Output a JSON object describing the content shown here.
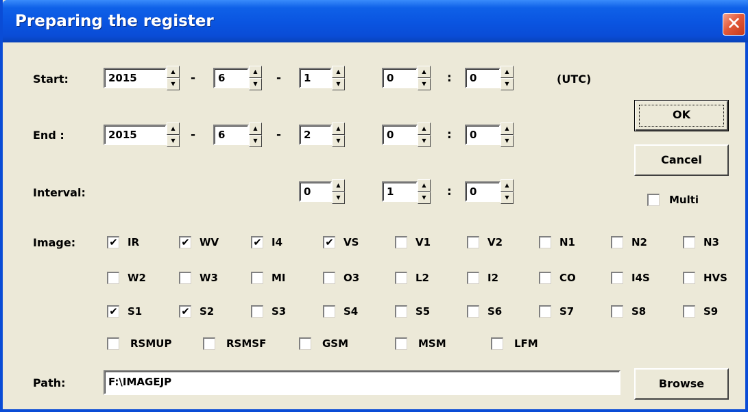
{
  "window": {
    "title": "Preparing the register",
    "close_glyph": "✕"
  },
  "labels": {
    "start": "Start:",
    "end": "End :",
    "interval": "Interval:",
    "image": "Image:",
    "path": "Path:",
    "utc": "(UTC)",
    "dash": "-",
    "colon": ":"
  },
  "start": {
    "year": "2015",
    "month": "6",
    "day": "1",
    "hour": "0",
    "minute": "0"
  },
  "end": {
    "year": "2015",
    "month": "6",
    "day": "2",
    "hour": "0",
    "minute": "0"
  },
  "interval": {
    "days": "0",
    "hours": "1",
    "minutes": "0"
  },
  "spin_glyphs": {
    "up": "▲",
    "down": "▼"
  },
  "buttons": {
    "ok": "OK",
    "cancel": "Cancel",
    "browse": "Browse"
  },
  "multi": {
    "label": "Multi",
    "checked": false
  },
  "check_glyph": "✔",
  "images": {
    "row1": [
      {
        "label": "IR",
        "checked": true
      },
      {
        "label": "WV",
        "checked": true
      },
      {
        "label": "I4",
        "checked": true
      },
      {
        "label": "VS",
        "checked": true
      },
      {
        "label": "V1",
        "checked": false
      },
      {
        "label": "V2",
        "checked": false
      },
      {
        "label": "N1",
        "checked": false
      },
      {
        "label": "N2",
        "checked": false
      },
      {
        "label": "N3",
        "checked": false
      }
    ],
    "row2": [
      {
        "label": "W2",
        "checked": false
      },
      {
        "label": "W3",
        "checked": false
      },
      {
        "label": "MI",
        "checked": false
      },
      {
        "label": "O3",
        "checked": false
      },
      {
        "label": "L2",
        "checked": false
      },
      {
        "label": "I2",
        "checked": false
      },
      {
        "label": "CO",
        "checked": false
      },
      {
        "label": "I4S",
        "checked": false
      },
      {
        "label": "HVS",
        "checked": false
      }
    ],
    "row3": [
      {
        "label": "S1",
        "checked": true
      },
      {
        "label": "S2",
        "checked": true
      },
      {
        "label": "S3",
        "checked": false
      },
      {
        "label": "S4",
        "checked": false
      },
      {
        "label": "S5",
        "checked": false
      },
      {
        "label": "S6",
        "checked": false
      },
      {
        "label": "S7",
        "checked": false
      },
      {
        "label": "S8",
        "checked": false
      },
      {
        "label": "S9",
        "checked": false
      }
    ],
    "row4": [
      {
        "label": "RSMUP",
        "checked": false
      },
      {
        "label": "RSMSF",
        "checked": false
      },
      {
        "label": "GSM",
        "checked": false
      },
      {
        "label": "MSM",
        "checked": false
      },
      {
        "label": "LFM",
        "checked": false
      }
    ]
  },
  "path": {
    "value": "F:\\IMAGEJP"
  }
}
